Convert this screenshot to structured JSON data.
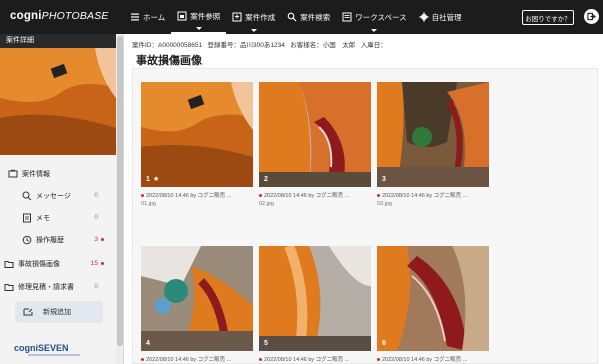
{
  "app": {
    "logo_main": "cogni",
    "logo_sub": "PHOTOBASE"
  },
  "nav": {
    "items": [
      {
        "label": "ホーム",
        "icon": "home-icon"
      },
      {
        "label": "案件参照",
        "icon": "case-view-icon"
      },
      {
        "label": "案件作成",
        "icon": "case-create-icon"
      },
      {
        "label": "案件検索",
        "icon": "search-icon"
      },
      {
        "label": "ワークスペース",
        "icon": "workspace-icon"
      },
      {
        "label": "自社管理",
        "icon": "gear-icon"
      }
    ],
    "help": "お困りですか？"
  },
  "sidebar": {
    "header": "案件詳細",
    "items": [
      {
        "label": "案件情報",
        "count": "",
        "icon": "case-info-icon"
      },
      {
        "label": "メッセージ",
        "count": "0",
        "icon": "message-icon"
      },
      {
        "label": "メモ",
        "count": "0",
        "icon": "memo-icon"
      },
      {
        "label": "操作履歴",
        "count": "3",
        "icon": "history-icon"
      },
      {
        "label": "事故損傷画像",
        "count": "15",
        "icon": "folder-icon"
      },
      {
        "label": "修理見積・請求書",
        "count": "0",
        "icon": "folder-icon"
      }
    ],
    "new_button": "新規追加",
    "brand": "cogniSEVEN"
  },
  "main": {
    "info": {
      "case_id": "案件ID：A00000058651",
      "reg_no": "登録番号：品川300あ1234",
      "customer": "お客様名：小国　太郎",
      "entry": "入庫日："
    },
    "title": "事故損傷画像",
    "photos": [
      {
        "num": "1",
        "star": "★",
        "caption": "2022/08/10 14:46 by コグニ販売 ...",
        "file": "01.jpg"
      },
      {
        "num": "2",
        "star": "",
        "caption": "2022/08/10 14:46 by コグニ販売 ...",
        "file": "02.jpg"
      },
      {
        "num": "3",
        "star": "",
        "caption": "2022/08/10 14:46 by コグニ販売 ...",
        "file": "03.jpg"
      },
      {
        "num": "4",
        "star": "",
        "caption": "2022/08/10 14:46 by コグニ販売 ...",
        "file": ""
      },
      {
        "num": "5",
        "star": "",
        "caption": "2022/08/10 14:46 by コグニ販売 ...",
        "file": ""
      },
      {
        "num": "6",
        "star": "",
        "caption": "2022/08/10 14:46 by コグニ販売 ...",
        "file": ""
      }
    ]
  },
  "colors": {
    "topbar": "#1c1c1c",
    "accent_red": "#c9312b",
    "car_orange": "#e07a1f"
  }
}
